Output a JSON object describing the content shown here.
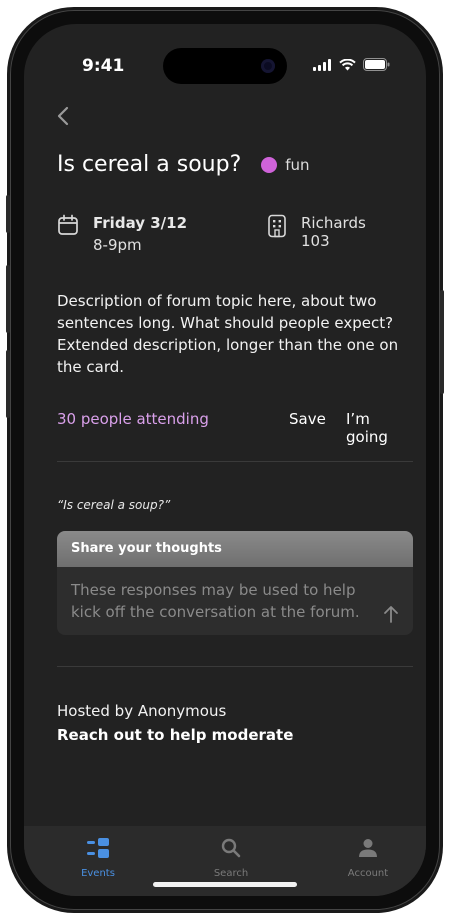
{
  "status": {
    "time": "9:41"
  },
  "event": {
    "title": "Is cereal a soup?",
    "tag": "fun",
    "tag_color": "#cf63d9",
    "date": "Friday 3/12",
    "time": "8-9pm",
    "location": "Richards 103",
    "description": "Description of forum topic here, about two sentences long. What should people expect? Extended description, longer than the one on the card."
  },
  "actions": {
    "attending": "30 people attending",
    "save_label": "Save",
    "going_label": "I’m going"
  },
  "thoughts": {
    "quote": "“Is cereal a soup?”",
    "header": "Share your thoughts",
    "placeholder": "These responses may be used to help kick off the conversation at the forum."
  },
  "host": {
    "hosted_by": "Hosted by Anonymous",
    "moderate_link": "Reach out to help moderate"
  },
  "tabbar": {
    "events": "Events",
    "search": "Search",
    "account": "Account",
    "active_color": "#4a90e2"
  }
}
